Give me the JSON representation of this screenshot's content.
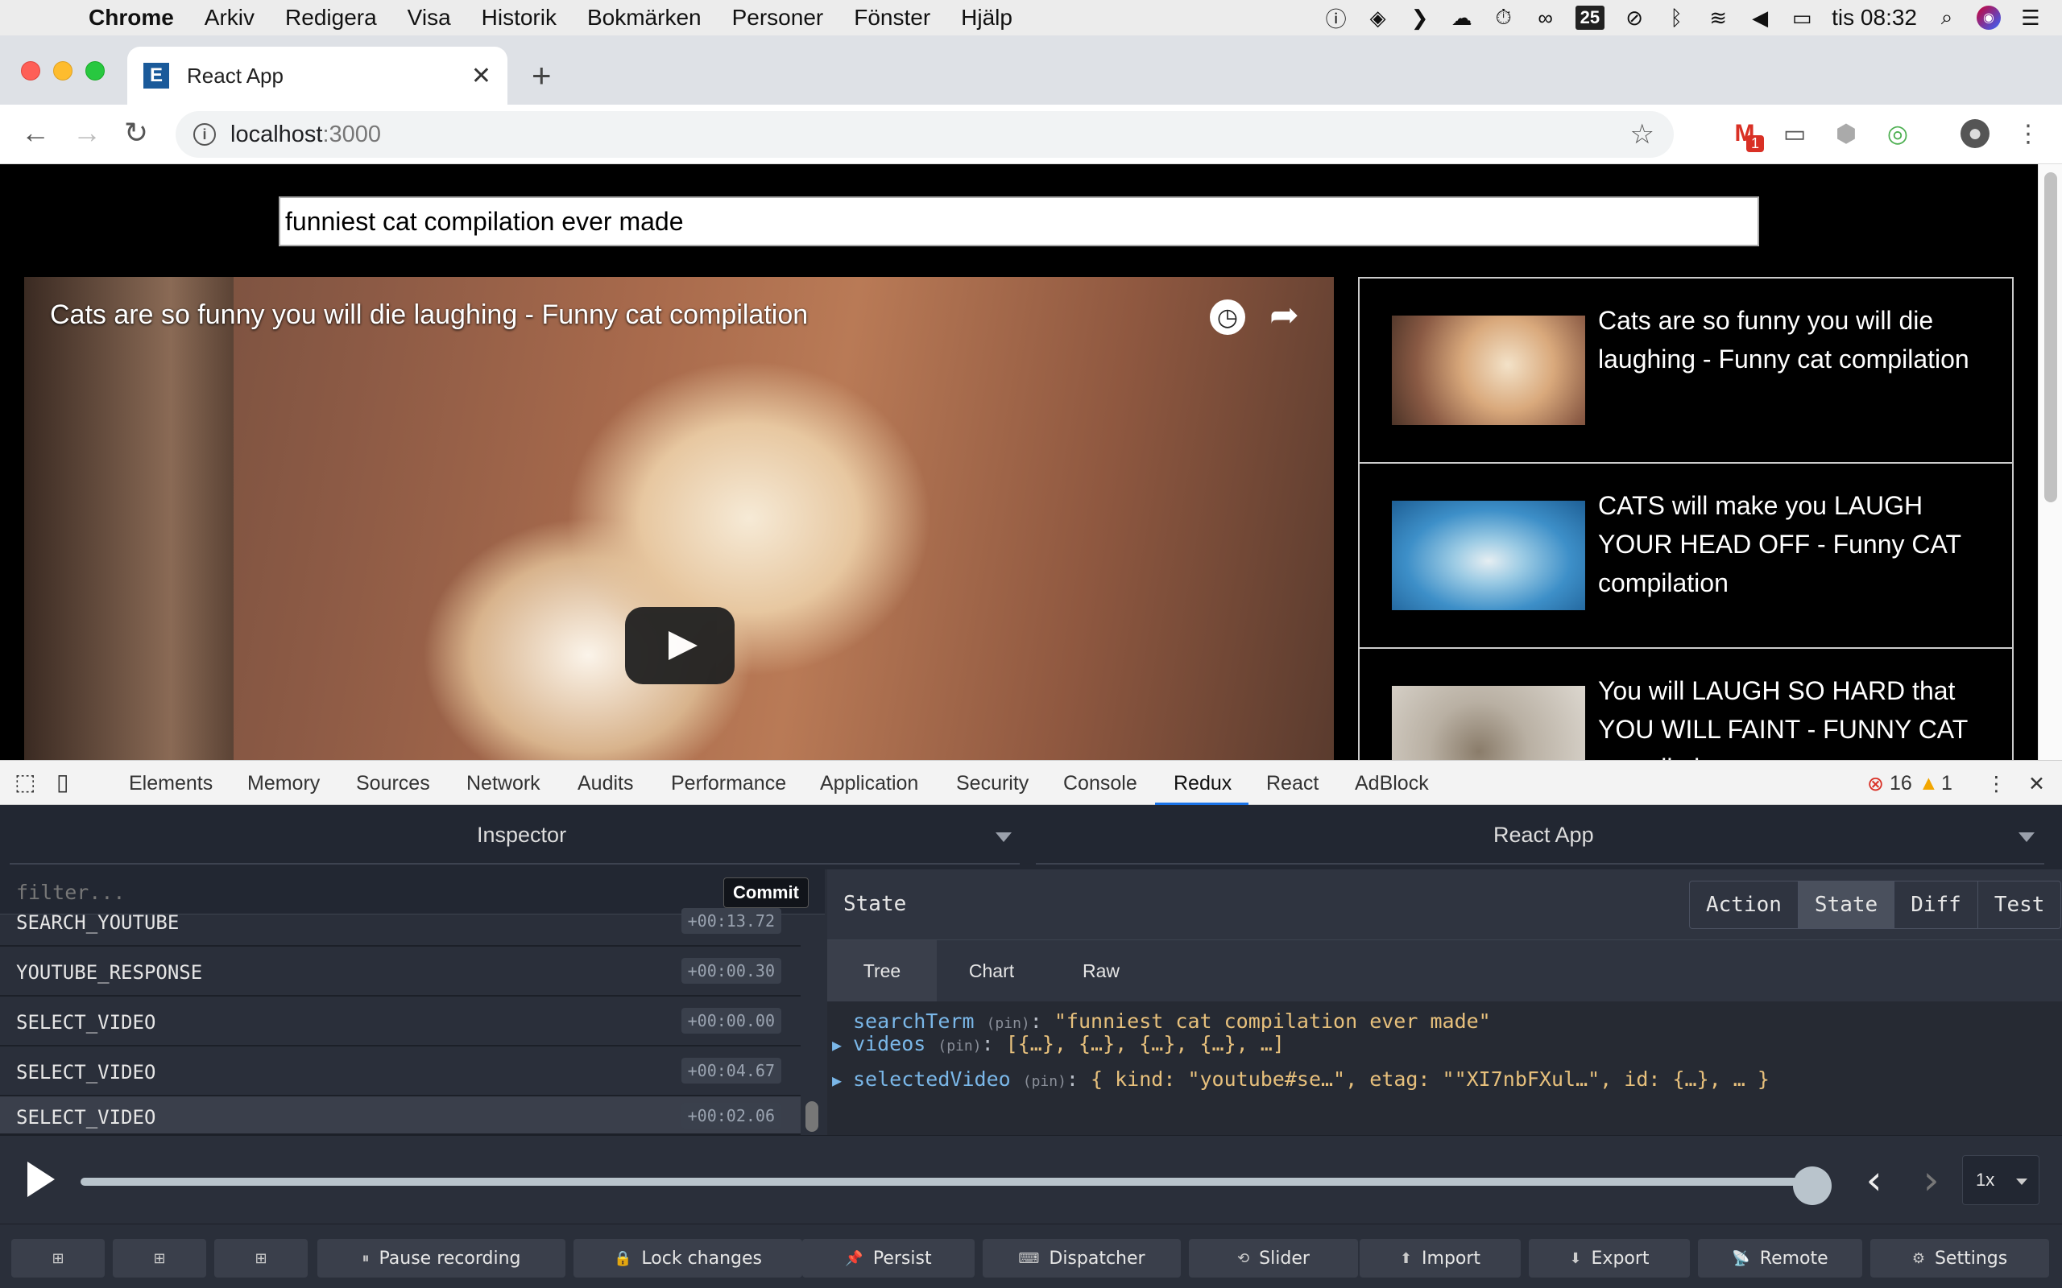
{
  "menubar": {
    "items": [
      "Chrome",
      "Arkiv",
      "Redigera",
      "Visa",
      "Historik",
      "Bokmärken",
      "Personer",
      "Fönster",
      "Hjälp"
    ],
    "calendar_badge": "25",
    "clock": "tis 08:32"
  },
  "browser": {
    "tab_title": "React App",
    "tab_favicon": "E",
    "url_host": "localhost",
    "url_port": ":3000",
    "gmail_badge": "1"
  },
  "app": {
    "search_value": "funniest cat compilation ever made",
    "player_title": "Cats are so funny you will die laughing - Funny cat compilation",
    "videos": [
      {
        "title": "Cats are so funny you will die laughing - Funny cat compilation"
      },
      {
        "title": "CATS will make you LAUGH YOUR HEAD OFF - Funny CAT compilation"
      },
      {
        "title": "You will LAUGH SO HARD that YOU WILL FAINT - FUNNY CAT compilation"
      }
    ]
  },
  "devtools": {
    "tabs": [
      "Elements",
      "Memory",
      "Sources",
      "Network",
      "Audits",
      "Performance",
      "Application",
      "Security",
      "Console",
      "Redux",
      "React",
      "AdBlock"
    ],
    "active_tab": "Redux",
    "errors": "16",
    "warnings": "1"
  },
  "redux": {
    "monitor_label": "Inspector",
    "instance_label": "React App",
    "filter_placeholder": "filter...",
    "commit_label": "Commit",
    "actions": [
      {
        "name": "SEARCH_YOUTUBE",
        "time": "+00:13.72"
      },
      {
        "name": "YOUTUBE_RESPONSE",
        "time": "+00:00.30"
      },
      {
        "name": "SELECT_VIDEO",
        "time": "+00:00.00"
      },
      {
        "name": "SELECT_VIDEO",
        "time": "+00:04.67"
      },
      {
        "name": "SELECT_VIDEO",
        "time": "+00:02.06"
      }
    ],
    "pane_title": "State",
    "segments": [
      "Action",
      "State",
      "Diff",
      "Test"
    ],
    "active_segment": "State",
    "subtabs": [
      "Tree",
      "Chart",
      "Raw"
    ],
    "active_subtab": "Tree",
    "tree": [
      {
        "key": "searchTerm",
        "pin": "(pin)",
        "value": "\"funniest cat compilation ever made\""
      },
      {
        "key": "videos",
        "pin": "(pin)",
        "value": "[{…}, {…}, {…}, {…}, …]"
      },
      {
        "key": "selectedVideo",
        "pin": "(pin)",
        "value": "{ kind: \"youtube#se…\", etag: \"\"XI7nbFXul…\", id: {…}, … }"
      }
    ],
    "slider_position": 1.0,
    "speed": "1x",
    "buttons": [
      "Pause recording",
      "Lock changes",
      "Persist",
      "Dispatcher",
      "Slider",
      "Import",
      "Export",
      "Remote",
      "Settings"
    ]
  },
  "colors": {
    "redux_bg": "#2a2f3a",
    "string_value": "#e7c07c",
    "key": "#7ab7e8",
    "devtools_active": "#1a73e8"
  }
}
